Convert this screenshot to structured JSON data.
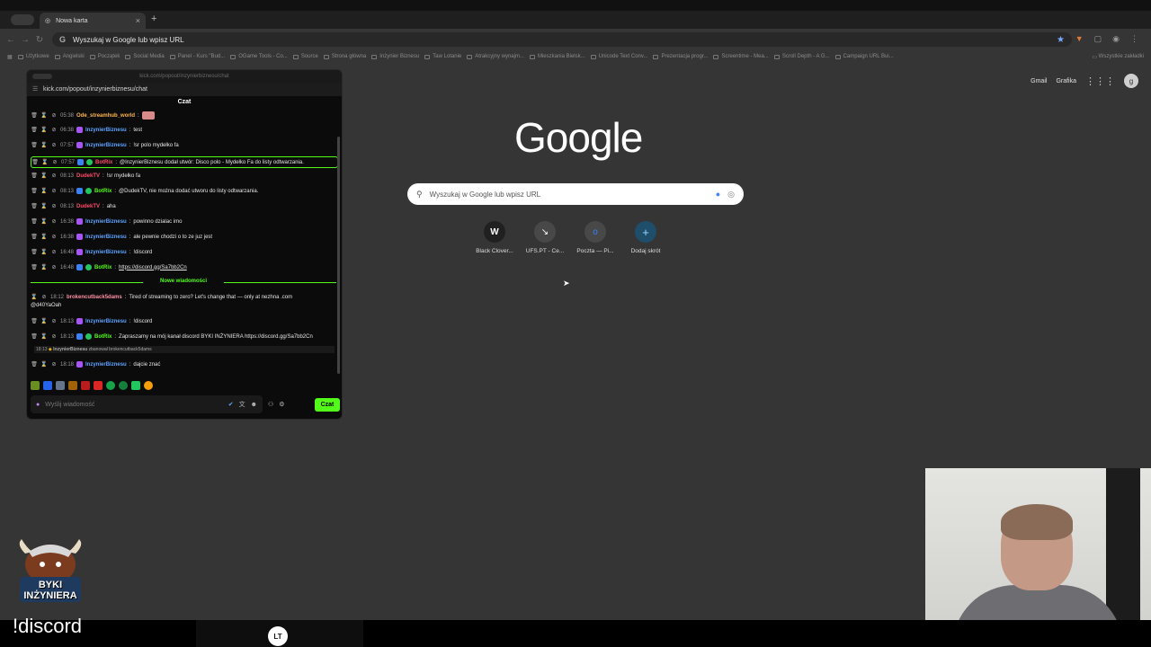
{
  "browser": {
    "tab_title": "Nowa karta",
    "tab_close": "×",
    "new_tab": "+",
    "omnibox_text": "Wyszukaj w Google lub wpisz URL",
    "bookmarks": [
      "Użytkowe",
      "Angielski",
      "Początek",
      "Social Media",
      "Panel - Kurs \"Bud...",
      "OGame Tools - Co...",
      "Source",
      "Strona główna",
      "Inżynier Biznesu",
      "Taw Lotanie",
      "Atrakcyjny wynajm...",
      "Mieszkania Bielsk...",
      "Unicode Text Conv...",
      "Prezentacja progr...",
      "Screentime - Mea...",
      "Scroll Depth - A G...",
      "Campaign URL Bui..."
    ],
    "bookmarks_right": "Wszystkie zakładki"
  },
  "newtab": {
    "gmail": "Gmail",
    "grafika": "Grafika",
    "profile_initial": "g",
    "logo": "Google",
    "search_placeholder": "Wyszukaj w Google lub wpisz URL",
    "shortcuts": [
      {
        "icon": "W",
        "label": "Black Clover..."
      },
      {
        "icon": "↘",
        "label": "UFS.PT - Ce..."
      },
      {
        "icon": "o",
        "label": "Poczta — Pi..."
      },
      {
        "icon": "+",
        "label": "Dodaj skrót"
      }
    ]
  },
  "popup": {
    "window_title": "kick.com/popout/inzynierbiznesu/chat",
    "url": "kick.com/popout/inzynierbiznesu/chat",
    "chat_title": "Czat",
    "messages": [
      {
        "time": "05:38",
        "user": "Ode_streamhub_world",
        "text": ""
      },
      {
        "time": "06:38",
        "user": "InzynierBiznesu",
        "text": "test"
      },
      {
        "time": "07:57",
        "user": "InzynierBiznesu",
        "text": "!sr polo mydełko fa"
      },
      {
        "time": "07:57",
        "user": "BotRix",
        "text": "@InzynierBiznesu dodał utwór: Disco polo - Mydełko Fa do listy odtwarzania."
      },
      {
        "time": "08:13",
        "user": "DudekTV",
        "text": "!sr mydełko fa"
      },
      {
        "time": "08:13",
        "user": "BotRix",
        "text": "@DudekTV, nie można dodać utworu do listy odtwarzania."
      },
      {
        "time": "08:13",
        "user": "DudekTV",
        "text": "aha"
      },
      {
        "time": "16:38",
        "user": "InzynierBiznesu",
        "text": "powinno dzialac imo"
      },
      {
        "time": "16:38",
        "user": "InzynierBiznesu",
        "text": "ale pewnie chodzi o to ze juz jest"
      },
      {
        "time": "16:48",
        "user": "InzynierBiznesu",
        "text": "!discord"
      },
      {
        "time": "16:48",
        "user": "BotRix",
        "text": "https://discord.gg/Sa7bb2Cn"
      },
      {
        "time": "18:12",
        "user": "brokencutback5dams",
        "text": "Tired of streaming to zero? Let's change that — only at nezhna .com"
      },
      {
        "time": "18:13",
        "user": "InzynierBiznesu",
        "text": "!discord"
      },
      {
        "time": "18:13",
        "user": "BotRix",
        "text": "Zapraszamy na mój kanał discord BYKI INŻYNIERA https://discord.gg/Sa7bb2Cn"
      },
      {
        "time": "18:18",
        "user": "InzynierBiznesu",
        "text": "dajcie znać"
      }
    ],
    "spam_continuation": "@d40YaOah",
    "new_messages": "Nowe wiadomości",
    "ban_note_time": "18:13",
    "ban_note_user": "InzynierBiznesu",
    "ban_note_text": "zbanował brokencutback5dams",
    "input_placeholder": "Wyślij wiadomość",
    "send_button": "Czat"
  },
  "overlay": {
    "logo_text": "BYKI INŻYNIERA",
    "command": "!discord",
    "dock_icon": "LT"
  },
  "colors": {
    "kick_green": "#53fc18",
    "chrome_bg": "#353535",
    "link_blue": "#5da3ff"
  }
}
